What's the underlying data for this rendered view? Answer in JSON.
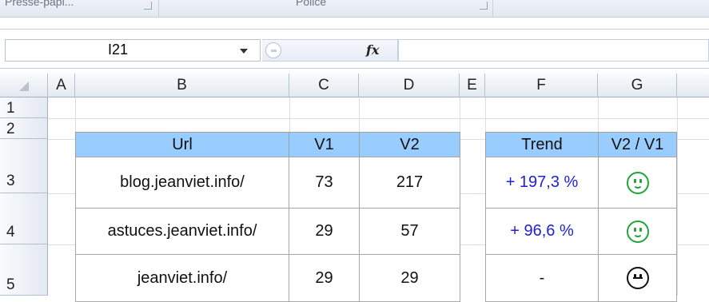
{
  "ribbon": {
    "groups": [
      "Presse-papi...",
      "Police"
    ]
  },
  "formula_bar": {
    "name_box": "I21",
    "fx_label": "fx",
    "formula": ""
  },
  "columns": [
    "A",
    "B",
    "C",
    "D",
    "E",
    "F",
    "G"
  ],
  "rows": [
    "1",
    "2",
    "3",
    "4",
    "5"
  ],
  "table1": {
    "headers": [
      "Url",
      "V1",
      "V2"
    ],
    "rows": [
      [
        "blog.jeanviet.info/",
        "73",
        "217"
      ],
      [
        "astuces.jeanviet.info/",
        "29",
        "57"
      ],
      [
        "jeanviet.info/",
        "29",
        "29"
      ]
    ]
  },
  "table2": {
    "headers": [
      "Trend",
      "V2 / V1"
    ],
    "rows": [
      {
        "trend": "+ 197,3 %",
        "icon": "smiley-happy-icon"
      },
      {
        "trend": "+ 96,6 %",
        "icon": "smiley-happy-icon"
      },
      {
        "trend": "-",
        "icon": "smiley-neutral-icon"
      }
    ]
  },
  "colors": {
    "header_fill": "#99ccff",
    "trend_positive": "#2020d8",
    "happy_icon": "#22a33a"
  }
}
